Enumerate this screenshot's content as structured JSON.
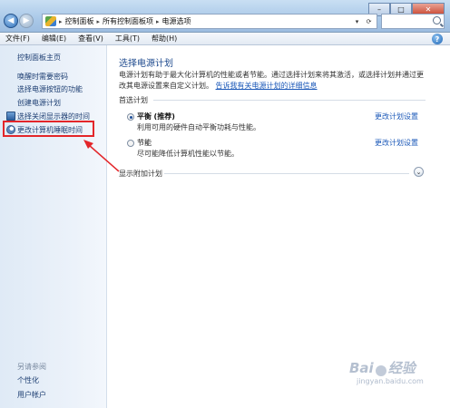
{
  "window": {
    "controls": {
      "minimize": "–",
      "maximize": "□",
      "close": "✕"
    },
    "address": {
      "crumbs": [
        "控制面板",
        "所有控制面板项",
        "电源选项"
      ],
      "separator": "▸"
    },
    "search": {
      "placeholder": ""
    }
  },
  "menubar": {
    "items": [
      "文件(F)",
      "编辑(E)",
      "查看(V)",
      "工具(T)",
      "帮助(H)"
    ]
  },
  "sidebar": {
    "home": "控制面板主页",
    "links": [
      "唤醒时需要密码",
      "选择电源按钮的功能",
      "创建电源计划",
      "选择关闭显示器的时间",
      "更改计算机睡眠时间"
    ],
    "see_also_heading": "另请参阅",
    "see_also": [
      "个性化",
      "用户帐户"
    ]
  },
  "main": {
    "title": "选择电源计划",
    "description": "电源计划有助于最大化计算机的性能或者节能。通过选择计划来将其激活，或选择计划并通过更改其电源设置来自定义计划。",
    "description_link": "告诉我有关电源计划的详细信息",
    "preferred_label": "首选计划",
    "plans": [
      {
        "name": "平衡",
        "tag": "(推荐)",
        "desc": "利用可用的硬件自动平衡功耗与性能。",
        "link": "更改计划设置",
        "selected": true
      },
      {
        "name": "节能",
        "tag": "",
        "desc": "尽可能降低计算机性能以节能。",
        "link": "更改计划设置",
        "selected": false
      }
    ],
    "additional_label": "显示附加计划"
  },
  "watermark": {
    "brand": "Bai",
    "brand2": "经验",
    "sub": "jingyan.baidu.com"
  },
  "colors": {
    "highlight": "#e3262a",
    "link": "#1b58b8",
    "title": "#1e4a8e"
  }
}
